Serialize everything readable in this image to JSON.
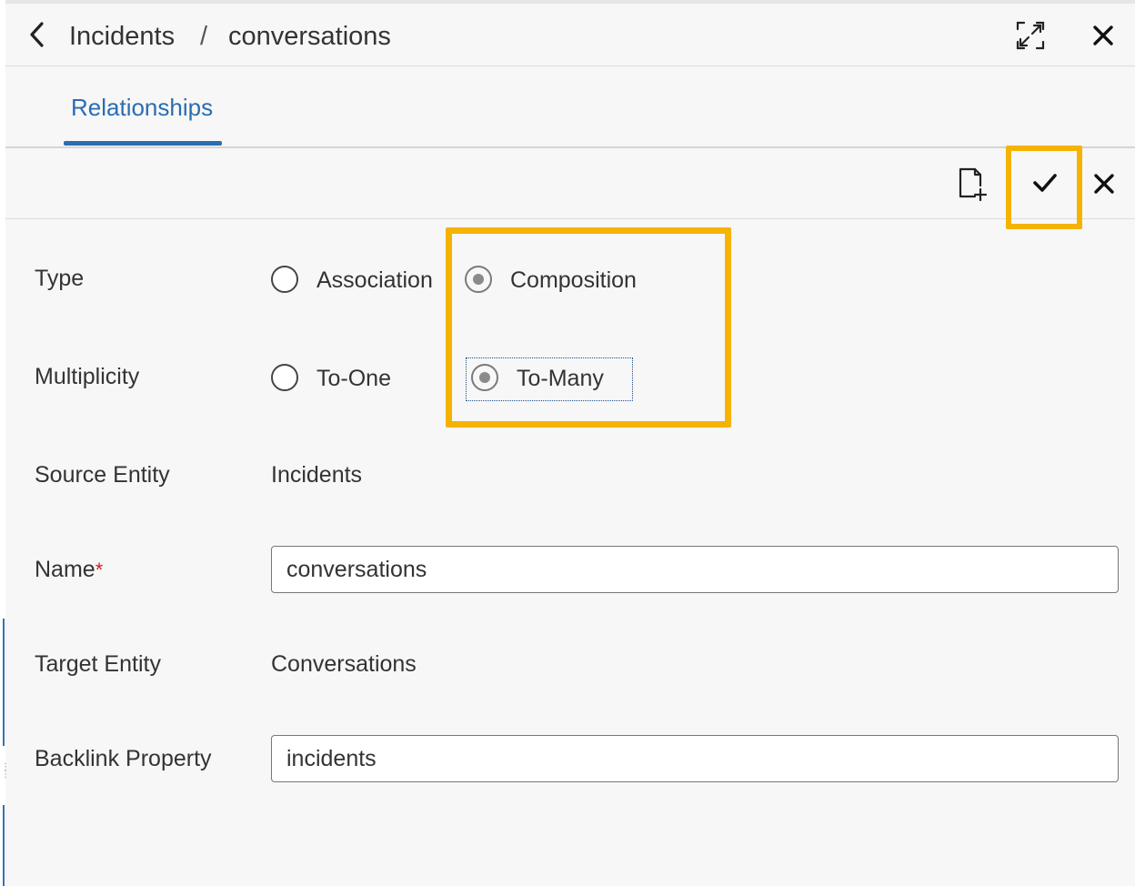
{
  "header": {
    "breadcrumb": [
      "Incidents",
      "conversations"
    ],
    "separator": "/",
    "back_icon": "chevron-left-icon",
    "expand_icon": "expand-icon",
    "close_icon": "close-icon"
  },
  "tabs": [
    {
      "label": "Relationships",
      "active": true
    }
  ],
  "toolbar": {
    "new_icon": "new-document-icon",
    "confirm_icon": "checkmark-icon",
    "close_icon": "close-icon"
  },
  "form": {
    "type": {
      "label": "Type",
      "options": [
        "Association",
        "Composition"
      ],
      "selected": "Composition"
    },
    "multiplicity": {
      "label": "Multiplicity",
      "options": [
        "To-One",
        "To-Many"
      ],
      "selected": "To-Many"
    },
    "source_entity": {
      "label": "Source Entity",
      "value": "Incidents"
    },
    "name": {
      "label": "Name",
      "required_mark": "*",
      "value": "conversations"
    },
    "target_entity": {
      "label": "Target Entity",
      "value": "Conversations"
    },
    "backlink_property": {
      "label": "Backlink Property",
      "value": "incidents"
    }
  },
  "colors": {
    "accent": "#2a6db3",
    "highlight": "#f5b300",
    "required": "#d02020"
  }
}
